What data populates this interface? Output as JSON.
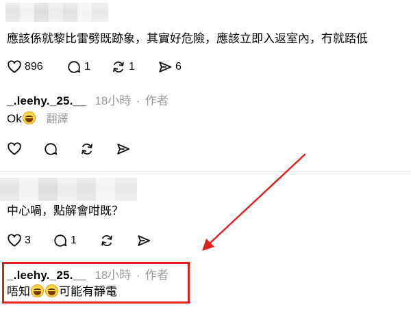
{
  "post1": {
    "text": "應該係就黎比雷劈既跡象，其實好危險，應該立即入返室內，冇就踎低",
    "actions": {
      "likes": "896",
      "replies": "1",
      "reposts": "1",
      "shares": "6"
    }
  },
  "reply1": {
    "username": "_.leehy._25.__",
    "time": "18小時",
    "separator": "·",
    "author_badge": "作者",
    "text": "Ok",
    "translate_label": "翻譯"
  },
  "post2": {
    "text": "中心喎，點解會咁既？",
    "actions": {
      "likes": "3",
      "replies": "1"
    }
  },
  "reply2": {
    "username": "_.leehy._25.__",
    "time": "18小時",
    "separator": "·",
    "author_badge": "作者",
    "text_before": "唔知",
    "text_after": "可能有靜電"
  },
  "colors": {
    "annotation_red": "#e02020",
    "muted_text": "#999999"
  },
  "icons": [
    "heart-icon",
    "comment-icon",
    "repost-icon",
    "send-icon",
    "grinning-emoji",
    "red-arrow"
  ]
}
